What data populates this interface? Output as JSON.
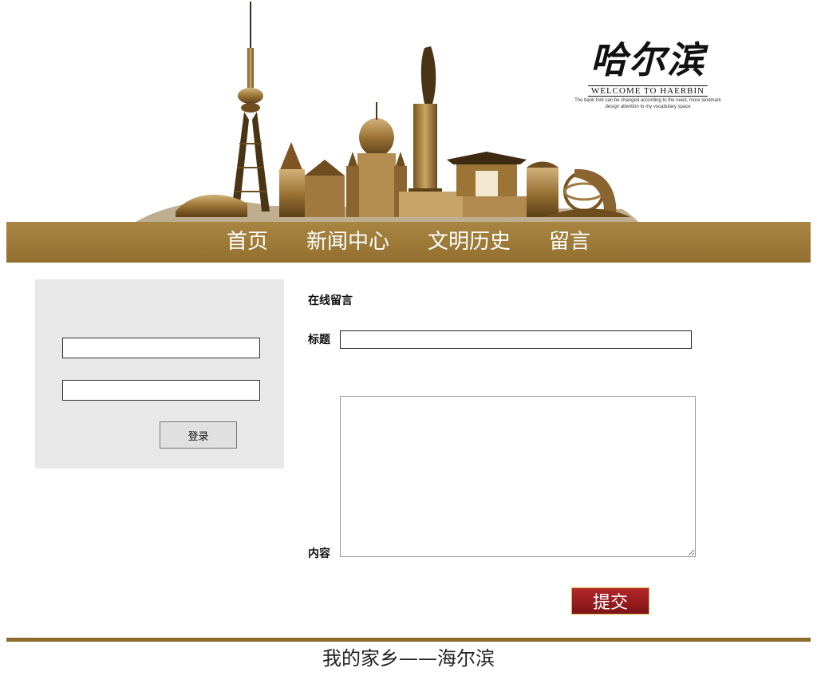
{
  "banner": {
    "logo_title": "哈尔滨",
    "logo_welcome": "WELCOME TO HAERBIN",
    "logo_sub_line1": "The bank font can be changed according to the need, more landmark",
    "logo_sub_line2": "design attention to my vocabulary space",
    "skyline_image": "harbin-landmarks-illustration"
  },
  "nav": {
    "items": [
      {
        "label": "首页"
      },
      {
        "label": "新闻中心"
      },
      {
        "label": "文明历史"
      },
      {
        "label": "留言"
      }
    ]
  },
  "login": {
    "username_value": "",
    "password_value": "",
    "button_label": "登录"
  },
  "form": {
    "heading": "在线留言",
    "title_label": "标题",
    "title_value": "",
    "content_label": "内容",
    "content_value": "",
    "submit_label": "提交"
  },
  "footer": {
    "text": "我的家乡——海尔滨"
  },
  "colors": {
    "nav_bg": "#9f7b39",
    "footer_line": "#8d6b2c",
    "submit_bg": "#9a1d20",
    "login_panel_bg": "#e8e8e8"
  }
}
